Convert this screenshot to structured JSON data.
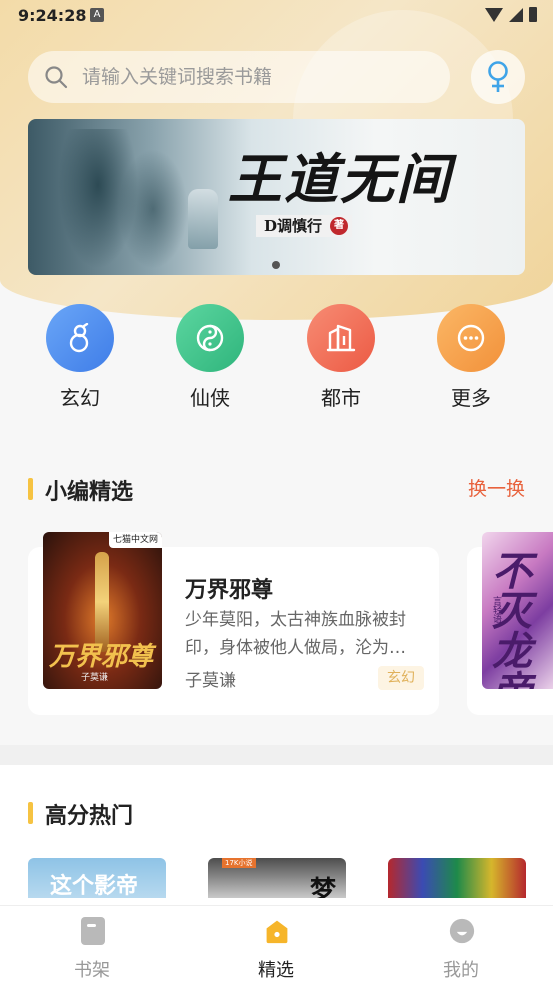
{
  "status_bar": {
    "time": "9:24:28",
    "notification_icon": "A"
  },
  "search": {
    "placeholder": "请输入关键词搜索书籍"
  },
  "banner": {
    "title": "王道无间",
    "author": "D调慎行",
    "author_seal": "著",
    "page_indicator": {
      "current": 1,
      "total": 1
    }
  },
  "categories": [
    {
      "label": "玄幻",
      "icon": "gourd-icon",
      "color": "#4f8cf0"
    },
    {
      "label": "仙侠",
      "icon": "taiji-icon",
      "color": "#3cc48c"
    },
    {
      "label": "都市",
      "icon": "building-icon",
      "color": "#f2705a"
    },
    {
      "label": "更多",
      "icon": "more-icon",
      "color": "#f5a04a"
    }
  ],
  "editor_picks": {
    "title": "小编精选",
    "refresh_label": "换一换",
    "books": [
      {
        "title": "万界邪尊",
        "description": "少年莫阳，太古神族血脉被封印，身体被他人做局，沦为…",
        "author": "子莫谦",
        "tag": "玄幻",
        "cover_title": "万界邪尊",
        "cover_author": "子莫谦",
        "cover_brand": "七猫中文网"
      },
      {
        "cover_title": "不灭龙帝",
        "cover_author": "言轻语"
      }
    ]
  },
  "hot": {
    "title": "高分热门",
    "books": [
      {
        "cover_text": "这个影帝"
      },
      {
        "cover_text": "梦",
        "cover_brand": "17K小说"
      },
      {
        "cover_text": ""
      }
    ]
  },
  "tab_bar": {
    "tabs": [
      {
        "label": "书架",
        "icon": "bookshelf-icon",
        "active": false
      },
      {
        "label": "精选",
        "icon": "featured-icon",
        "active": true
      },
      {
        "label": "我的",
        "icon": "profile-icon",
        "active": false
      }
    ]
  },
  "colors": {
    "accent": "#f6c342",
    "refresh": "#e8623d",
    "tab_active": "#f6b52a"
  }
}
